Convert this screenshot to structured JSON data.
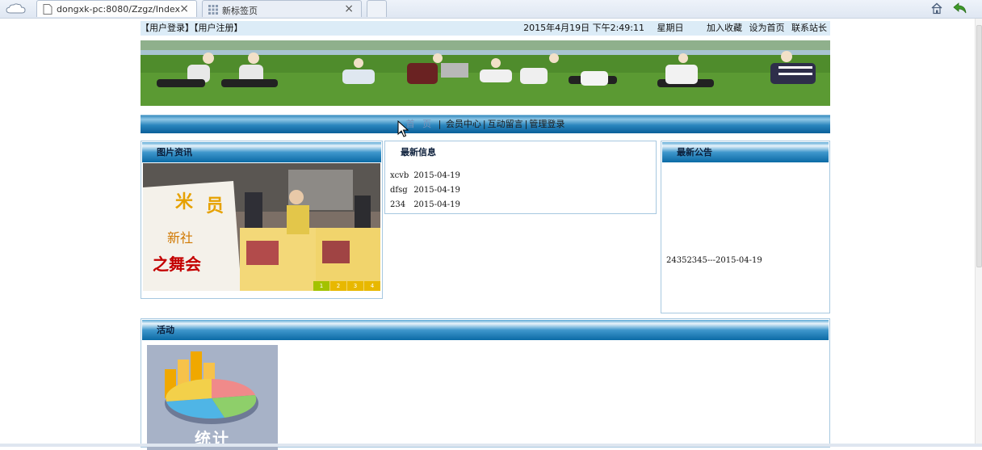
{
  "browser": {
    "tabs": [
      {
        "title": "dongxk-pc:8080/Zzgz/Index",
        "close": "×"
      },
      {
        "title": "新标签页",
        "close": "×"
      }
    ]
  },
  "topbar": {
    "login": "【用户登录】",
    "register": "【用户注册】",
    "datetime": "2015年4月19日 下午2:49:11",
    "weekday": "星期日",
    "links": [
      "加入收藏",
      "设为首页",
      "联系站长"
    ]
  },
  "nav": {
    "items": [
      "首 页",
      "会员中心",
      "互动留言",
      "管理登录"
    ],
    "separator": "|"
  },
  "picture_news": {
    "title": "图片资讯",
    "slide_pages": [
      "1",
      "2",
      "3",
      "4"
    ],
    "active_page": "1",
    "poster_text": [
      "米",
      "员",
      "新社",
      "之舞会"
    ]
  },
  "latest_news": {
    "title": "最新信息",
    "items": [
      {
        "title": "xcvb",
        "date": "2015-04-19"
      },
      {
        "title": "dfsg",
        "date": "2015-04-19"
      },
      {
        "title": "234",
        "date": "2015-04-19"
      }
    ]
  },
  "announcements": {
    "title": "最新公告",
    "items": [
      "24352345---2015-04-19"
    ]
  },
  "activity": {
    "title": "活动",
    "image_label": "统计"
  },
  "colors": {
    "topbar_bg": "#dcecf7",
    "nav_blue": "#0a5f99",
    "box_border": "#a7c8e0",
    "heading_text": "#0b1e3a"
  }
}
